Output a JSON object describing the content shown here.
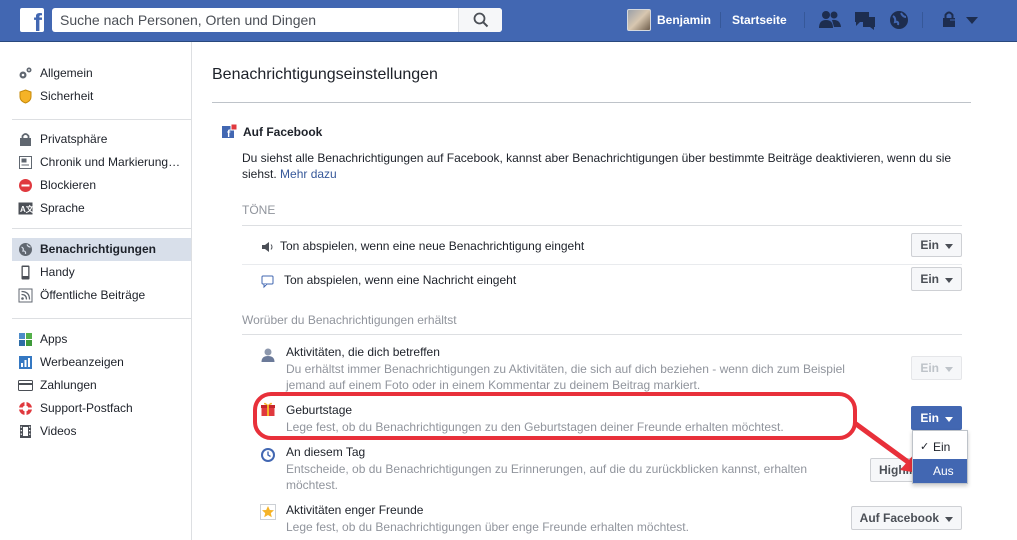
{
  "header": {
    "search_placeholder": "Suche nach Personen, Orten und Dingen",
    "user_name": "Benjamin",
    "home_label": "Startseite",
    "brand_color": "#4267b2"
  },
  "sidebar": {
    "groups": [
      [
        {
          "label": "Allgemein",
          "icon": "gears-icon"
        },
        {
          "label": "Sicherheit",
          "icon": "badge-icon"
        }
      ],
      [
        {
          "label": "Privatsphäre",
          "icon": "lock-icon"
        },
        {
          "label": "Chronik und Markierung…",
          "icon": "timeline-icon"
        },
        {
          "label": "Blockieren",
          "icon": "block-icon"
        },
        {
          "label": "Sprache",
          "icon": "language-icon"
        }
      ],
      [
        {
          "label": "Benachrichtigungen",
          "icon": "globe-icon",
          "active": true
        },
        {
          "label": "Handy",
          "icon": "phone-icon"
        },
        {
          "label": "Öffentliche Beiträge",
          "icon": "rss-icon"
        }
      ],
      [
        {
          "label": "Apps",
          "icon": "apps-icon"
        },
        {
          "label": "Werbeanzeigen",
          "icon": "ads-icon"
        },
        {
          "label": "Zahlungen",
          "icon": "card-icon"
        },
        {
          "label": "Support-Postfach",
          "icon": "lifebuoy-icon"
        },
        {
          "label": "Videos",
          "icon": "film-icon"
        }
      ]
    ]
  },
  "main": {
    "title": "Benachrichtigungseinstellungen",
    "section_title": "Auf Facebook",
    "description": "Du siehst alle Benachrichtigungen auf Facebook, kannst aber Benachrichtigungen über bestimmte Beiträge deaktivieren, wenn du sie siehst.",
    "more_link": "Mehr dazu",
    "sounds_label": "TÖNE",
    "sounds": [
      {
        "label": "Ton abspielen, wenn eine neue Benachrichtigung eingeht",
        "value": "Ein",
        "icon": "speaker-icon"
      },
      {
        "label": "Ton abspielen, wenn eine Nachricht eingeht",
        "value": "Ein",
        "icon": "chat-icon"
      }
    ],
    "receive_label": "Worüber du Benachrichtigungen erhältst",
    "settings": [
      {
        "title": "Aktivitäten, die dich betreffen",
        "subtitle": "Du erhältst immer Benachrichtigungen zu Aktivitäten, die sich auf dich beziehen - wenn dich zum Beispiel jemand auf einem Foto oder in einem Kommentar zu deinem Beitrag markiert.",
        "value": "Ein",
        "state": "disabled",
        "icon": "person-icon"
      },
      {
        "title": "Geburtstage",
        "subtitle": "Lege fest, ob du Benachrichtigungen zu den Geburtstagen deiner Freunde erhalten möchtest.",
        "value": "Ein",
        "state": "open",
        "icon": "gift-icon"
      },
      {
        "title": "An diesem Tag",
        "subtitle": "Entscheide, ob du Benachrichtigungen zu Erinnerungen, auf die du zurückblicken kannst, erhalten möchtest.",
        "value": "Highli",
        "state": "normal",
        "icon": "clock-icon"
      },
      {
        "title": "Aktivitäten enger Freunde",
        "subtitle": "Lege fest, ob du Benachrichtigungen über enge Freunde erhalten möchtest.",
        "value": "Auf Facebook",
        "state": "normal",
        "icon": "star-icon"
      }
    ],
    "dropdown": {
      "options": [
        "Ein",
        "Aus"
      ],
      "checked": "Ein",
      "hovered": "Aus"
    }
  },
  "annotation": {
    "color": "#e8303a"
  }
}
